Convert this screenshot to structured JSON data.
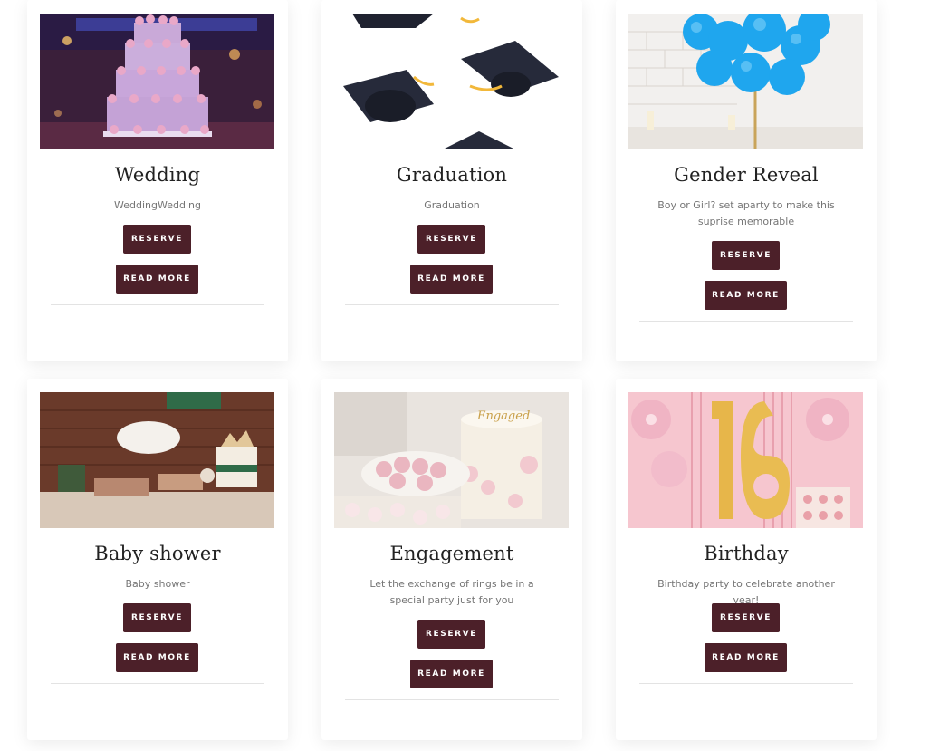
{
  "buttons": {
    "reserve": "RESERVE",
    "read_more": "READ MORE"
  },
  "colors": {
    "button_bg": "#4c2029",
    "title": "#222222",
    "description": "#757575"
  },
  "services": [
    {
      "title": "Wedding",
      "description": "WeddingWedding",
      "image": "wedding-cake"
    },
    {
      "title": "Graduation",
      "description": "Graduation",
      "image": "graduation-caps"
    },
    {
      "title": "Gender Reveal",
      "description": "Boy or Girl? set aparty to make this suprise memorable",
      "image": "blue-balloons"
    },
    {
      "title": "Baby shower",
      "description": "Baby shower",
      "image": "dessert-table"
    },
    {
      "title": "Engagement",
      "description": "Let the exchange of rings be in a special party just for you",
      "image": "engagement-cake"
    },
    {
      "title": "Birthday",
      "description": "Birthday party to celebrate another year!",
      "image": "birthday-16-balloons"
    }
  ]
}
